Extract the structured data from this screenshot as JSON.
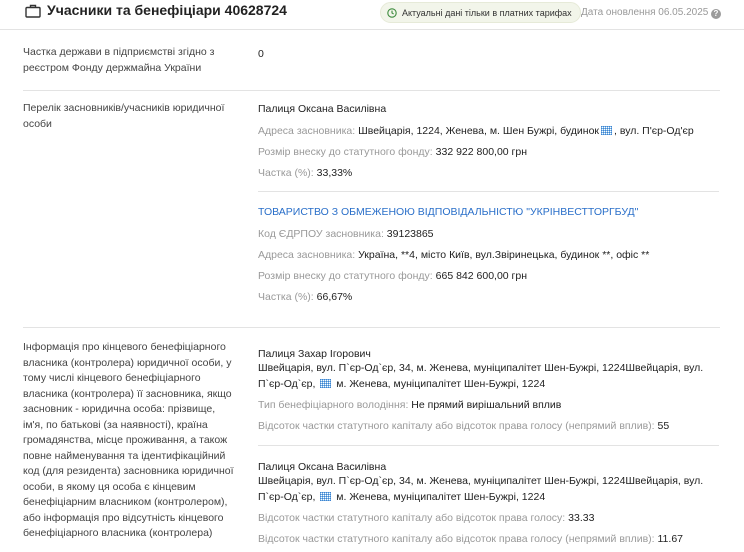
{
  "header": {
    "title": "Учасники та бенефіціари 40628724",
    "badge": "Актуальні дані тільки в платних тарифах",
    "updated": "Дата оновлення 06.05.2025",
    "help": "?"
  },
  "state_share": {
    "label": "Частка держави в підприємстві згідно з реєстром Фонду держмайна України",
    "value": "0"
  },
  "founders": {
    "label": "Перелік засновників/учасників юридичної особи",
    "items": [
      {
        "name": "Палиця Оксана Василівна",
        "address_label": "Адреса засновника:",
        "address_pre": "Швейцарія, 1224, Женева, м. Шен Бужрі, будинок",
        "address_post": ", вул. П'єр-Од'єр",
        "capital_label": "Розмір внеску до статутного фонду:",
        "capital_value": "332 922 800,00 грн",
        "share_label": "Частка (%):",
        "share_value": "33,33%"
      },
      {
        "name": "ТОВАРИСТВО З ОБМЕЖЕНОЮ ВІДПОВІДАЛЬНІСТЮ \"УКРІНВЕСТТОРГБУД\"",
        "edrpou_label": "Код ЄДРПОУ засновника:",
        "edrpou_value": "39123865",
        "address_label": "Адреса засновника:",
        "address_value": "Україна, **4, місто Київ, вул.Звіринецька, будинок **, офіс **",
        "capital_label": "Розмір внеску до статутного фонду:",
        "capital_value": "665 842 600,00 грн",
        "share_label": "Частка (%):",
        "share_value": "66,67%"
      }
    ]
  },
  "beneficiaries": {
    "label": "Інформація про кінцевого бенефіціарного власника (контролера) юридичної особи, у тому числі кінцевого бенефіціарного власника (контролера) її засновника, якщо засновник - юридична особа: прізвище, ім'я, по батькові (за наявності), країна громадянства, місце проживання, а також повне найменування та ідентифікаційний код (для резидента) засновника юридичної особи, в якому ця особа є кінцевим бенефіціарним власником (контролером), або інформація про відсутність кінцевого бенефіціарного власника (контролера)",
    "items": [
      {
        "name": "Палиця Захар Ігорович",
        "addr_line1": "Швейцарія, вул. П`єр-Од`єр, 34, м. Женева, муніципалітет Шен-Бужрі, 1224Швейцарія, вул.",
        "addr_line2_pre": "П`єр-Од`єр,",
        "addr_line2_post": "м. Женева, муніципалітет Шен-Бужрі, 1224",
        "type_label": "Тип бенефіціарного володіння:",
        "type_value": "Не прямий вирішальний вплив",
        "percent_label": "Відсоток частки статутного капіталу або відсоток права голосу (непрямий вплив):",
        "percent_value": "55"
      },
      {
        "name": "Палиця Оксана Василівна",
        "addr_line1": "Швейцарія, вул. П`єр-Од`єр, 34, м. Женева, муніципалітет Шен-Бужрі, 1224Швейцарія, вул.",
        "addr_line2_pre": "П`єр-Од`єр,",
        "addr_line2_post": "м. Женева, муніципалітет Шен-Бужрі, 1224",
        "direct_label": "Відсоток частки статутного капіталу або відсоток права голосу:",
        "direct_value": "33.33",
        "percent_label": "Відсоток частки статутного капіталу або відсоток права голосу (непрямий вплив):",
        "percent_value": "11.67"
      }
    ]
  }
}
